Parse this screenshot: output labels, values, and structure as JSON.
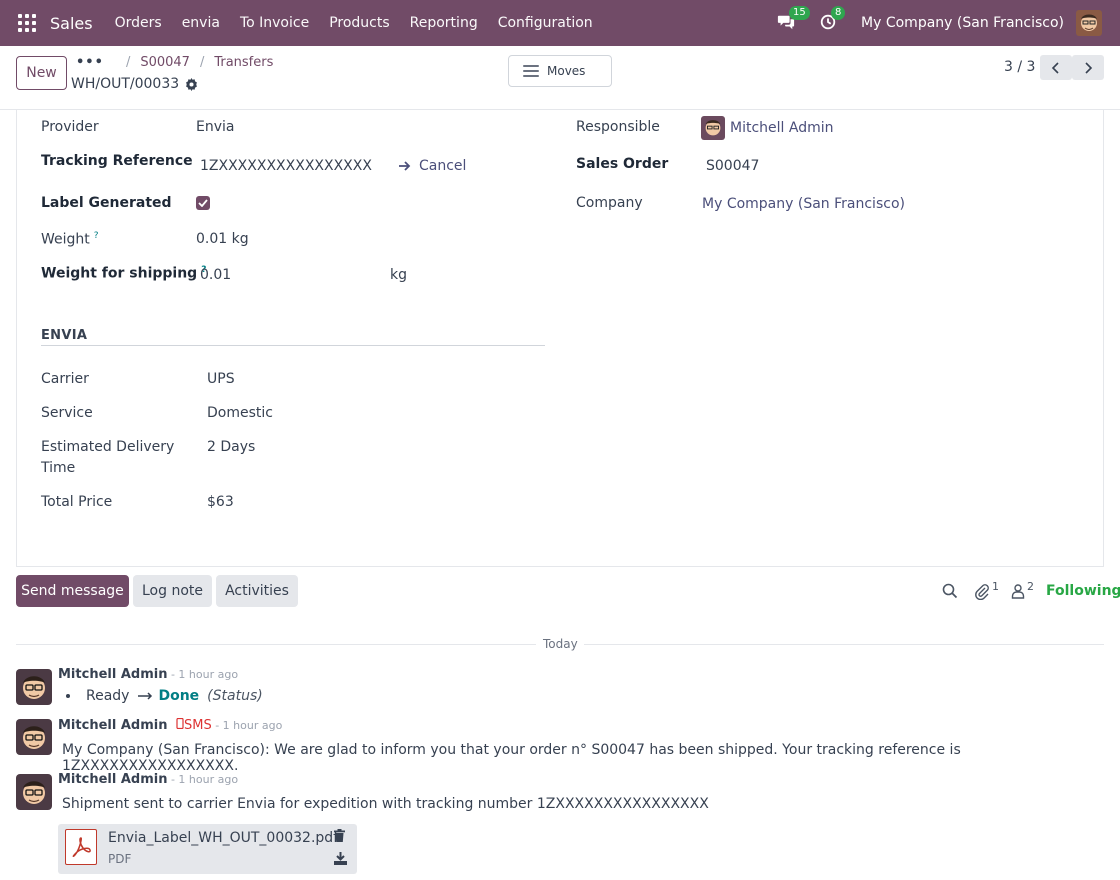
{
  "topbar": {
    "app_name": "Sales",
    "menu": [
      "Orders",
      "envia",
      "To Invoice",
      "Products",
      "Reporting",
      "Configuration"
    ],
    "messages_count": "15",
    "activities_count": "8",
    "company": "My Company (San Francisco)"
  },
  "control": {
    "new_label": "New",
    "breadcrumb_dots": "•••",
    "breadcrumb": [
      "S00047",
      "Transfers"
    ],
    "record_name": "WH/OUT/00033",
    "moves_label": "Moves",
    "pager": "3 / 3"
  },
  "form": {
    "provider_label": "Provider",
    "provider_value": "Envia",
    "tracking_label": "Tracking Reference",
    "tracking_value": "1ZXXXXXXXXXXXXXXXX",
    "cancel_label": "Cancel",
    "label_generated_label": "Label Generated",
    "label_generated": true,
    "weight_label": "Weight",
    "weight_value": "0.01 kg",
    "weight_shipping_label": "Weight for shipping",
    "weight_shipping_value": "0.01",
    "weight_shipping_unit": "kg",
    "help_mark": "?",
    "responsible_label": "Responsible",
    "responsible_value": "Mitchell Admin",
    "sales_order_label": "Sales Order",
    "sales_order_value": "S00047",
    "company_label": "Company",
    "company_value": "My Company (San Francisco)",
    "envia_section": {
      "title": "ENVIA",
      "carrier_label": "Carrier",
      "carrier_value": "UPS",
      "service_label": "Service",
      "service_value": "Domestic",
      "eta_label_1": "Estimated Delivery",
      "eta_label_2": "Time",
      "eta_value": "2 Days",
      "price_label": "Total Price",
      "price_value": "$63"
    }
  },
  "chatter": {
    "send_message": "Send message",
    "log_note": "Log note",
    "activities": "Activities",
    "attachments_count": "1",
    "followers_count": "2",
    "following": "Following",
    "today": "Today",
    "messages": [
      {
        "author": "Mitchell Admin",
        "time": " - 1 hour ago",
        "status_from": "Ready",
        "status_to": "Done",
        "status_field": "(Status)"
      },
      {
        "author": "Mitchell Admin",
        "sms_label": "SMS",
        "time": " - 1 hour ago",
        "body": "My Company (San Francisco): We are glad to inform you that your order n° S00047 has been shipped. Your tracking reference is 1ZXXXXXXXXXXXXXXXX."
      },
      {
        "author": "Mitchell Admin",
        "time": " - 1 hour ago",
        "body": "Shipment sent to carrier Envia for expedition with tracking number 1ZXXXXXXXXXXXXXXXX",
        "attachment_name": "Envia_Label_WH_OUT_00032.pdf",
        "attachment_type": "PDF"
      }
    ]
  },
  "colors": {
    "brand": "#714B67",
    "badge_green": "#2fa64f",
    "following_green": "#28a745",
    "done_teal": "#017e84"
  }
}
